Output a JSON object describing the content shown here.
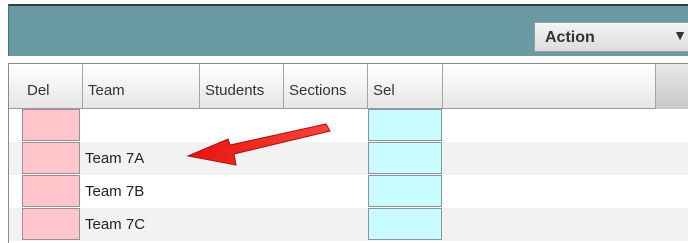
{
  "toolbar": {
    "action_label": "Action"
  },
  "table": {
    "columns": [
      "Del",
      "Team",
      "Students",
      "Sections",
      "Sel"
    ],
    "rows": [
      {
        "team": ""
      },
      {
        "team": "Team 7A"
      },
      {
        "team": "Team 7B"
      },
      {
        "team": "Team 7C"
      }
    ]
  },
  "colors": {
    "toolbar_bg": "#6a9aa3",
    "del_cell": "#ffc5cb",
    "sel_cell": "#c8fcfe",
    "annotation_arrow": "#f0231c"
  }
}
